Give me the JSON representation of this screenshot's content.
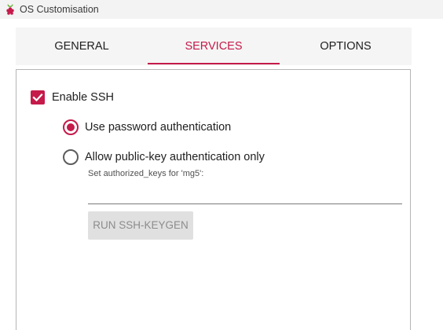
{
  "window": {
    "title": "OS Customisation",
    "icon": "raspberry-icon"
  },
  "tabs": [
    {
      "label": "GENERAL",
      "active": false
    },
    {
      "label": "SERVICES",
      "active": true
    },
    {
      "label": "OPTIONS",
      "active": false
    }
  ],
  "services": {
    "enable_ssh": {
      "label": "Enable SSH",
      "checked": true
    },
    "auth_options": [
      {
        "label": "Use password authentication",
        "selected": true
      },
      {
        "label": "Allow public-key authentication only",
        "selected": false
      }
    ],
    "authorized_keys": {
      "hint": "Set authorized_keys for 'mg5':",
      "value": ""
    },
    "keygen_button": {
      "label": "RUN SSH-KEYGEN",
      "enabled": false
    }
  },
  "colors": {
    "accent": "#c51a4a",
    "tab_bar": "#f5f5f5",
    "disabled_button": "#e0e0e0"
  }
}
